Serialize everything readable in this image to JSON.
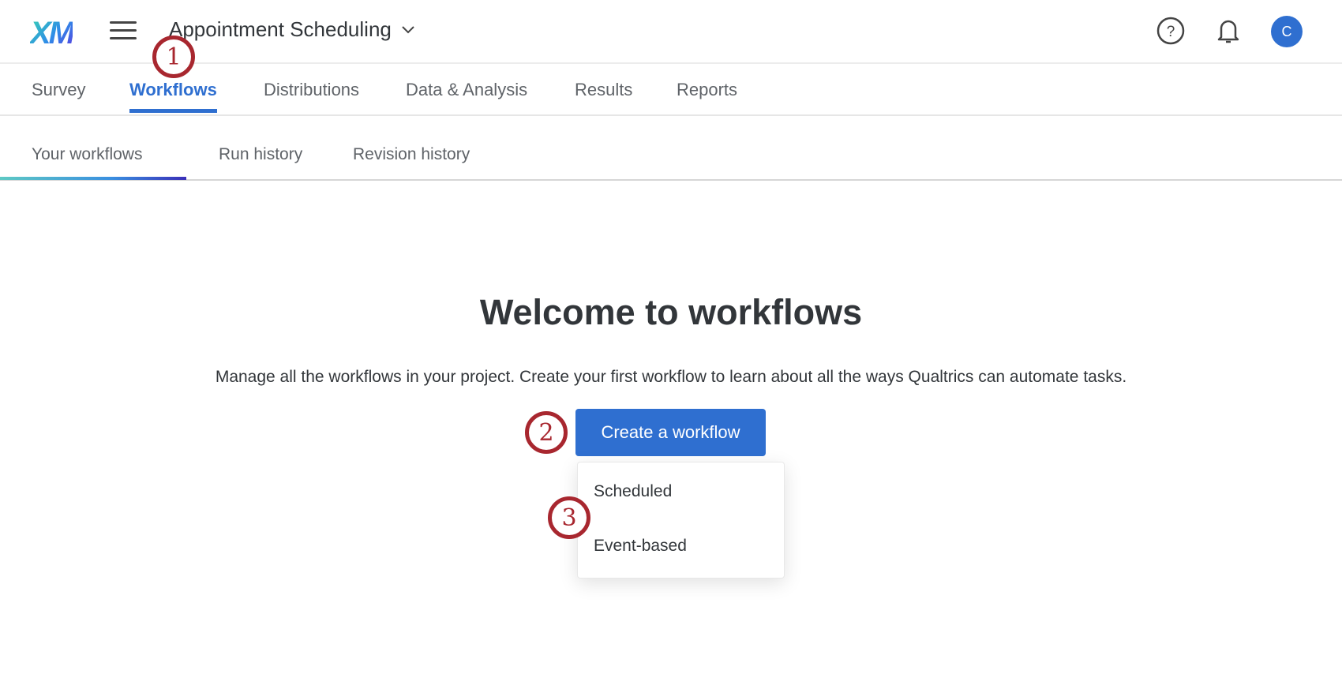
{
  "header": {
    "logo": "XM",
    "project_title": "Appointment Scheduling",
    "avatar_initial": "C"
  },
  "tabs": [
    {
      "label": "Survey"
    },
    {
      "label": "Workflows"
    },
    {
      "label": "Distributions"
    },
    {
      "label": "Data & Analysis"
    },
    {
      "label": "Results"
    },
    {
      "label": "Reports"
    }
  ],
  "subtabs": [
    {
      "label": "Your workflows"
    },
    {
      "label": "Run history"
    },
    {
      "label": "Revision history"
    }
  ],
  "main": {
    "heading": "Welcome to workflows",
    "description": "Manage all the workflows in your project. Create your first workflow to learn about all the ways Qualtrics can automate tasks.",
    "create_button": "Create a workflow",
    "menu": [
      {
        "label": "Scheduled"
      },
      {
        "label": "Event-based"
      }
    ]
  },
  "annotations": [
    "1",
    "2",
    "3"
  ],
  "colors": {
    "accent": "#2f6fd0",
    "annotation": "#a8272f"
  }
}
